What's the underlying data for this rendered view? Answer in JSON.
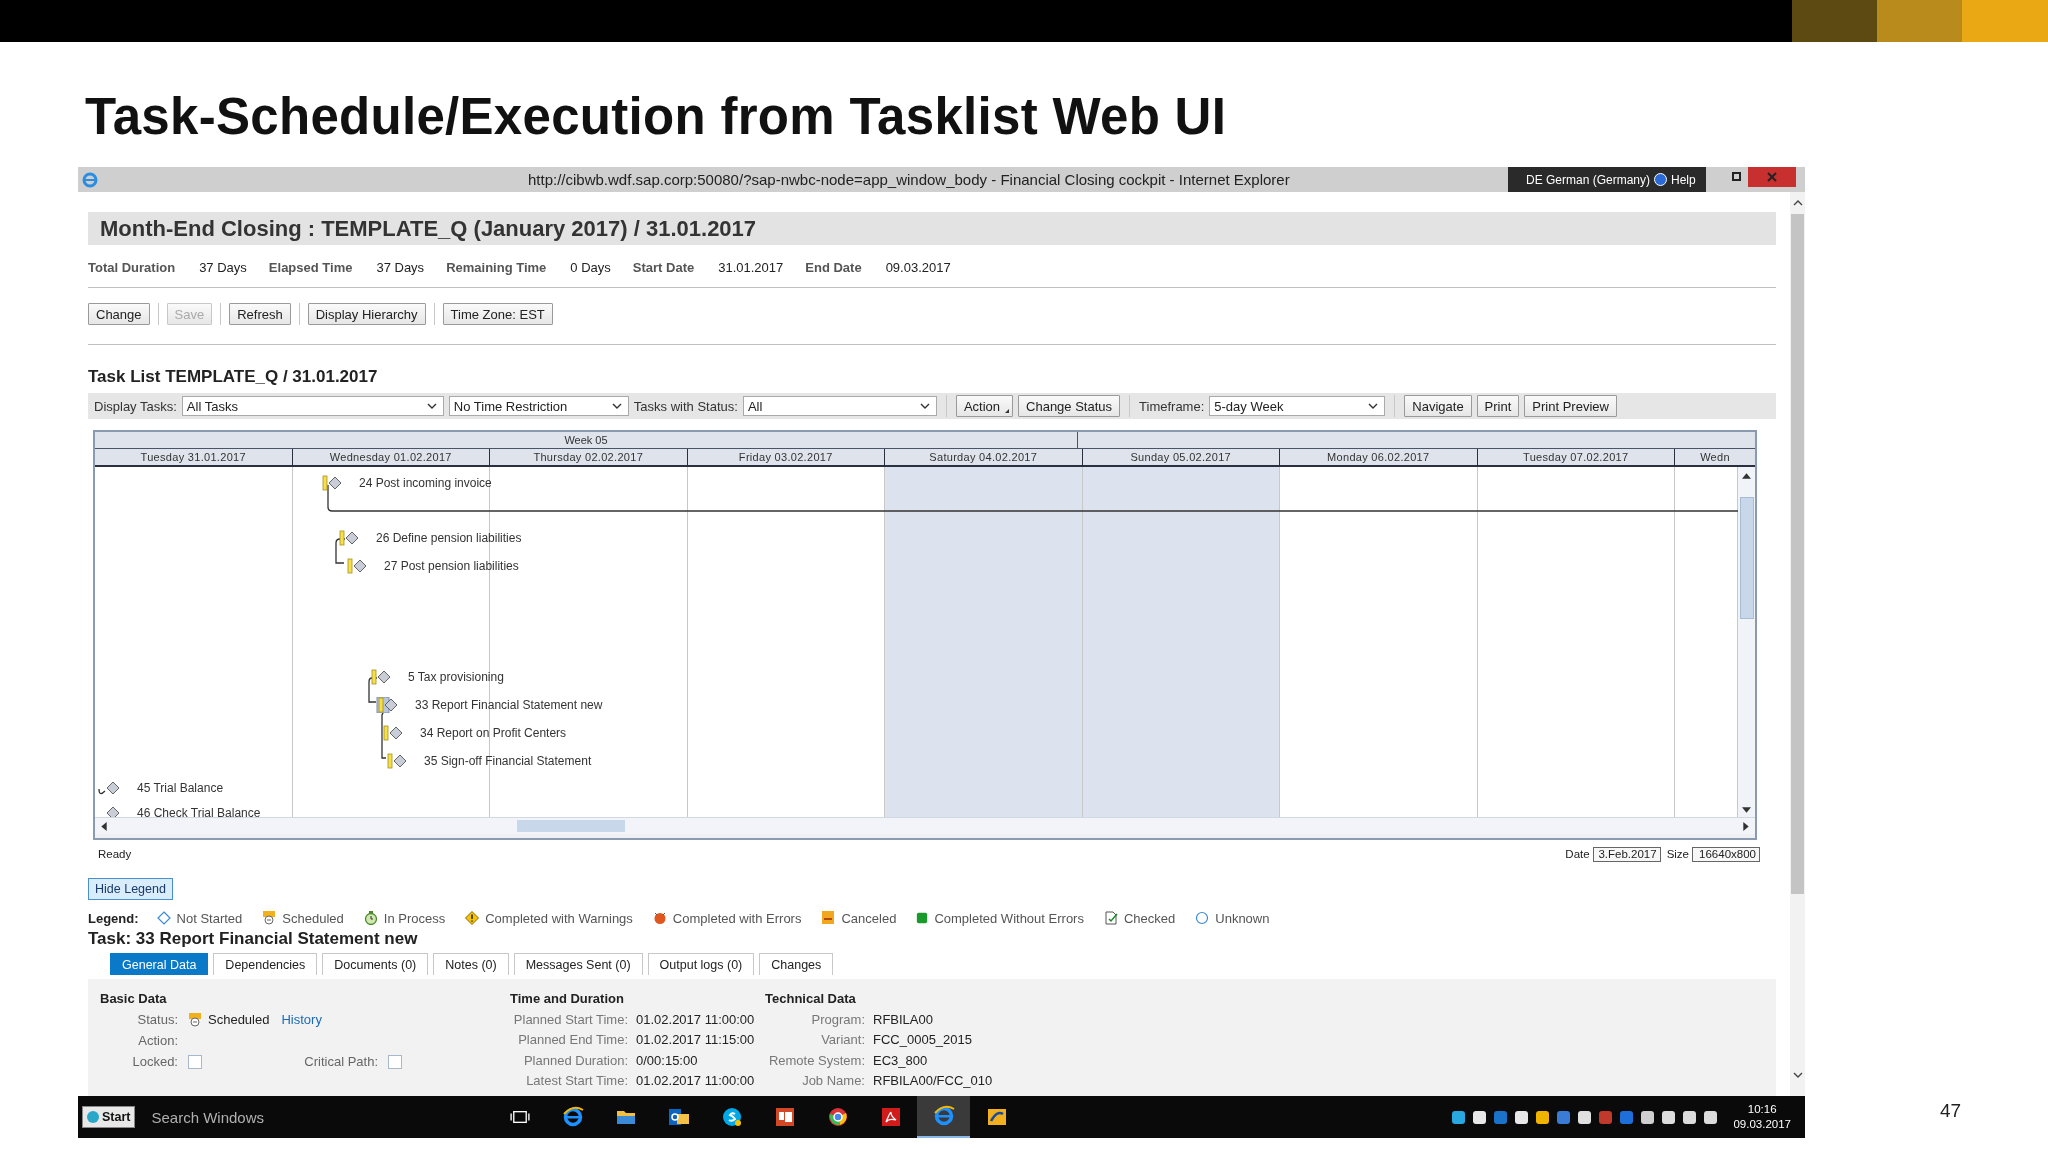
{
  "slide": {
    "title": "Task-Schedule/Execution from Tasklist Web UI",
    "page_number": "47"
  },
  "browser": {
    "title": "http://cibwb.wdf.sap.corp:50080/?sap-nwbc-node=app_window_body - Financial Closing cockpit - Internet Explorer",
    "language": "DE German (Germany)",
    "help": "Help"
  },
  "header": {
    "title": "Month-End Closing : TEMPLATE_Q (January 2017) / 31.01.2017",
    "facts": [
      {
        "label": "Total Duration",
        "value": "37 Days"
      },
      {
        "label": "Elapsed Time",
        "value": "37 Days"
      },
      {
        "label": "Remaining Time",
        "value": "0 Days"
      },
      {
        "label": "Start Date",
        "value": "31.01.2017"
      },
      {
        "label": "End Date",
        "value": "09.03.2017"
      }
    ]
  },
  "actions": [
    {
      "label": "Change",
      "disabled": false
    },
    {
      "label": "Save",
      "disabled": true
    },
    {
      "label": "Refresh",
      "disabled": false
    },
    {
      "label": "Display Hierarchy",
      "disabled": false
    },
    {
      "label": "Time Zone: EST",
      "disabled": false
    }
  ],
  "task_list": {
    "title": "Task List TEMPLATE_Q / 31.01.2017",
    "toolbar": [
      {
        "kind": "select",
        "label": "Display Tasks:",
        "value": "All Tasks"
      },
      {
        "kind": "select",
        "value": "No Time Restriction"
      },
      {
        "kind": "select",
        "label": "Tasks with Status:",
        "value": "All"
      },
      {
        "kind": "separator"
      },
      {
        "kind": "menu",
        "label": "Action"
      },
      {
        "kind": "button",
        "label": "Change Status"
      },
      {
        "kind": "separator"
      },
      {
        "kind": "select",
        "label": "Timeframe:",
        "value": "5-day Week"
      },
      {
        "kind": "separator"
      },
      {
        "kind": "button",
        "label": "Navigate"
      },
      {
        "kind": "button",
        "label": "Print"
      },
      {
        "kind": "button",
        "label": "Print Preview"
      }
    ]
  },
  "gantt": {
    "week": "Week 05",
    "days": [
      {
        "label": "Tuesday 31.01.2017",
        "weekend": false
      },
      {
        "label": "Wednesday 01.02.2017",
        "weekend": false
      },
      {
        "label": "Thursday 02.02.2017",
        "weekend": false
      },
      {
        "label": "Friday 03.02.2017",
        "weekend": false
      },
      {
        "label": "Saturday 04.02.2017",
        "weekend": true
      },
      {
        "label": "Sunday 05.02.2017",
        "weekend": true
      },
      {
        "label": "Monday 06.02.2017",
        "weekend": false
      },
      {
        "label": "Tuesday 07.02.2017",
        "weekend": false
      },
      {
        "label": "Wedn",
        "weekend": false
      }
    ],
    "tasks": [
      {
        "label": "24 Post incoming invoice",
        "kind": "scheduled",
        "selected": false
      },
      {
        "label": "26 Define pension liabilities",
        "kind": "scheduled",
        "selected": false
      },
      {
        "label": "27 Post pension liabilities",
        "kind": "scheduled",
        "selected": false
      },
      {
        "label": "5 Tax provisioning",
        "kind": "scheduled",
        "selected": false
      },
      {
        "label": "33 Report Financial Statement new",
        "kind": "scheduled",
        "selected": true
      },
      {
        "label": "34 Report on Profit Centers",
        "kind": "scheduled",
        "selected": false
      },
      {
        "label": "35 Sign-off Financial Statement",
        "kind": "scheduled",
        "selected": false
      },
      {
        "label": "45 Trial Balance",
        "kind": "not_started",
        "selected": false
      },
      {
        "label": "46 Check Trial Balance",
        "kind": "not_started",
        "selected": false
      }
    ],
    "status": "Ready",
    "date_label": "Date",
    "date": "3.Feb.2017",
    "size_label": "Size",
    "size": "16640x800"
  },
  "legend": {
    "button": "Hide Legend",
    "title": "Legend:",
    "items": [
      {
        "kind": "not_started",
        "label": "Not Started"
      },
      {
        "kind": "scheduled",
        "label": "Scheduled"
      },
      {
        "kind": "in_process",
        "label": "In Process"
      },
      {
        "kind": "warnings",
        "label": "Completed with Warnings"
      },
      {
        "kind": "errors",
        "label": "Completed with Errors"
      },
      {
        "kind": "canceled",
        "label": "Canceled"
      },
      {
        "kind": "ok",
        "label": "Completed Without Errors"
      },
      {
        "kind": "checked",
        "label": "Checked"
      },
      {
        "kind": "unknown",
        "label": "Unknown"
      }
    ]
  },
  "task": {
    "title": "Task: 33 Report Financial Statement new",
    "tabs": [
      {
        "label": "General Data",
        "selected": true
      },
      {
        "label": "Dependencies",
        "selected": false
      },
      {
        "label": "Documents (0)",
        "selected": false
      },
      {
        "label": "Notes (0)",
        "selected": false
      },
      {
        "label": "Messages Sent (0)",
        "selected": false
      },
      {
        "label": "Output logs (0)",
        "selected": false
      },
      {
        "label": "Changes",
        "selected": false
      }
    ],
    "basic": {
      "title": "Basic Data",
      "status_label": "Status:",
      "status": "Scheduled",
      "history": "History",
      "action_label": "Action:",
      "locked_label": "Locked:",
      "locked": false,
      "critical_label": "Critical Path:",
      "critical_path": false
    },
    "time": {
      "title": "Time and Duration",
      "rows": [
        {
          "label": "Planned Start Time:",
          "value": "01.02.2017 11:00:00"
        },
        {
          "label": "Planned End Time:",
          "value": "01.02.2017 11:15:00"
        },
        {
          "label": "Planned Duration:",
          "value": "0/00:15:00"
        },
        {
          "label": "Latest Start Time:",
          "value": "01.02.2017 11:00:00"
        }
      ]
    },
    "technical": {
      "title": "Technical Data",
      "rows": [
        {
          "label": "Program:",
          "value": "RFBILA00"
        },
        {
          "label": "Variant:",
          "value": "FCC_0005_2015"
        },
        {
          "label": "Remote System:",
          "value": "EC3_800"
        },
        {
          "label": "Job Name:",
          "value": "RFBILA00/FCC_010"
        }
      ]
    }
  },
  "taskbar": {
    "start": "Start",
    "search_placeholder": "Search Windows",
    "apps": [
      {
        "kind": "task_view",
        "selected": false
      },
      {
        "kind": "browser",
        "selected": false
      },
      {
        "kind": "folder",
        "selected": false
      },
      {
        "kind": "mail",
        "selected": false
      },
      {
        "kind": "chat",
        "selected": false
      },
      {
        "kind": "slides",
        "selected": false
      },
      {
        "kind": "circle",
        "selected": false
      },
      {
        "kind": "pdf",
        "selected": false
      },
      {
        "kind": "browser",
        "selected": true
      },
      {
        "kind": "app",
        "selected": false
      }
    ],
    "time": "10:16",
    "date": "09.03.2017"
  }
}
